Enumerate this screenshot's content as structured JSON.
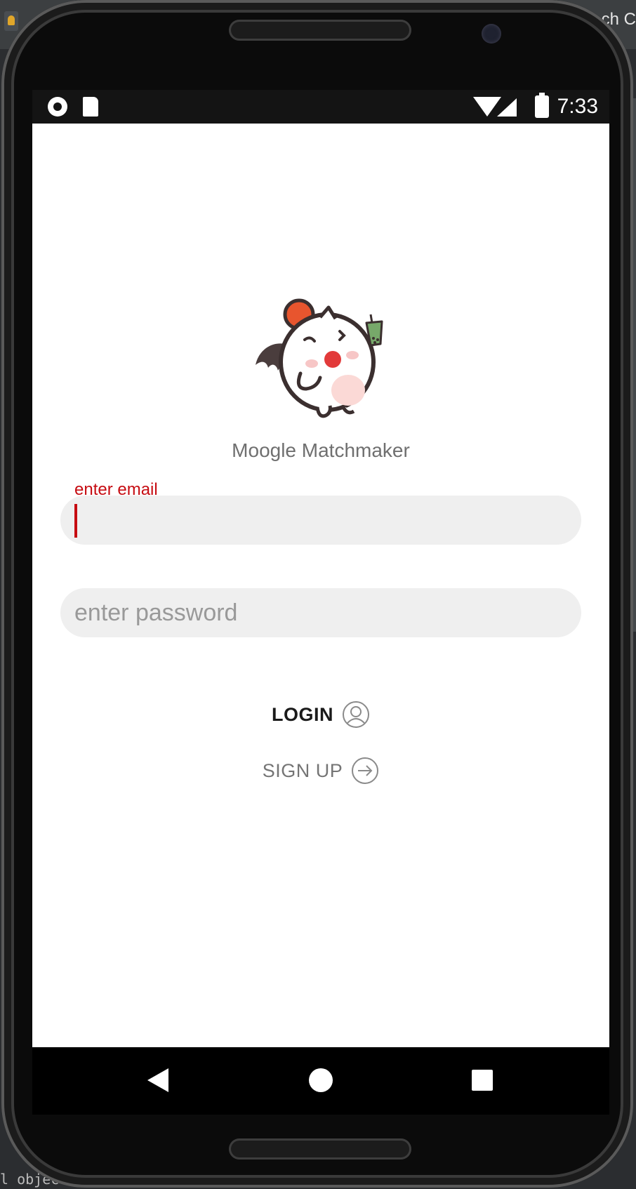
{
  "desktop": {
    "top_right_text": "ch C",
    "bottom_left_text": "l objec"
  },
  "status_bar": {
    "left_icons": [
      "record-icon",
      "sd-card-icon"
    ],
    "right_icons": [
      "wifi-icon",
      "cell-signal-icon",
      "battery-charging-icon"
    ],
    "time": "7:33"
  },
  "app": {
    "name": "Moogle Matchmaker",
    "logo_icon": "moogle-mascot-icon"
  },
  "form": {
    "email": {
      "label": "enter email",
      "value": ""
    },
    "password": {
      "placeholder": "enter password",
      "value": ""
    }
  },
  "actions": {
    "login_label": "LOGIN",
    "login_icon": "user-circle-icon",
    "signup_label": "SIGN UP",
    "signup_icon": "arrow-right-circle-icon"
  },
  "nav_bar": {
    "icons": [
      "back-icon",
      "home-icon",
      "recents-icon"
    ]
  },
  "colors": {
    "accent_error": "#c60c12",
    "field_bg": "#efefef",
    "status_bar_bg": "#141414",
    "mascot_pom": "#e8552e"
  }
}
